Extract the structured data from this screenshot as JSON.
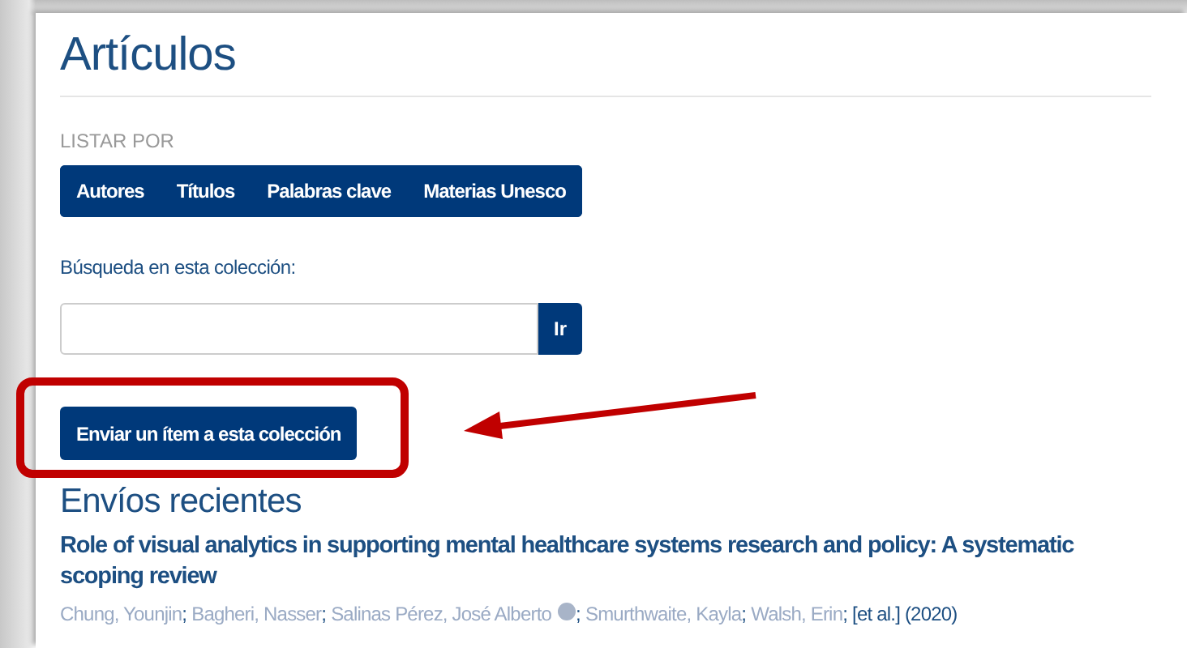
{
  "page_title": "Artículos",
  "browse": {
    "label": "LISTAR POR",
    "buttons": [
      "Autores",
      "Títulos",
      "Palabras clave",
      "Materias Unesco"
    ]
  },
  "search": {
    "label": "Búsqueda en esta colección:",
    "button": "Ir"
  },
  "submit_button": "Enviar un ítem a esta colección",
  "recent": {
    "heading": "Envíos recientes",
    "items": [
      {
        "title": "Role of visual analytics in supporting mental healthcare systems research and policy: A systematic scoping review",
        "authors": [
          {
            "name": "Chung, Younjin",
            "orcid": false,
            "sep": ";"
          },
          {
            "name": "Bagheri, Nasser",
            "orcid": false,
            "sep": ";"
          },
          {
            "name": "Salinas Pérez, José Alberto",
            "orcid": true,
            "sep": ";"
          },
          {
            "name": "Smurthwaite, Kayla",
            "orcid": false,
            "sep": ";"
          },
          {
            "name": "Walsh, Erin",
            "orcid": false,
            "sep": ";"
          }
        ],
        "tail": "[et al.] (2020)"
      }
    ]
  }
}
